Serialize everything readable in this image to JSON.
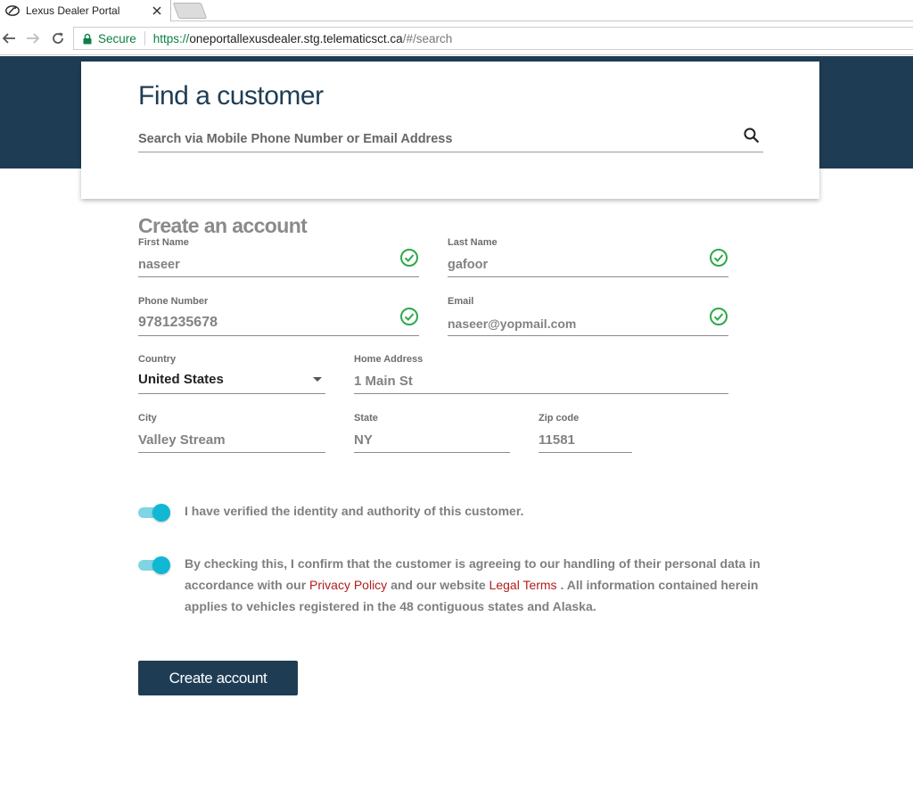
{
  "browser": {
    "tab_title": "Lexus Dealer Portal",
    "secure_label": "Secure",
    "url_scheme": "https://",
    "url_host": "oneportallexusdealer.stg.telematicsct.ca",
    "url_path": "/#/search"
  },
  "search": {
    "title": "Find a customer",
    "placeholder": "Search via Mobile Phone Number or Email Address"
  },
  "form": {
    "title": "Create an account",
    "first_name": {
      "label": "First Name",
      "value": "naseer"
    },
    "last_name": {
      "label": "Last Name",
      "value": "gafoor"
    },
    "phone": {
      "label": "Phone Number",
      "value": "9781235678"
    },
    "email": {
      "label": "Email",
      "value": "naseer@yopmail.com"
    },
    "country": {
      "label": "Country",
      "value": "United States"
    },
    "address": {
      "label": "Home Address",
      "value": "1 Main St"
    },
    "city": {
      "label": "City",
      "value": "Valley Stream"
    },
    "state": {
      "label": "State",
      "value": "NY"
    },
    "zip": {
      "label": "Zip code",
      "value": "11581"
    }
  },
  "consent": {
    "verify_text": "I have verified the identity and authority of this customer.",
    "agree_text_1": "By checking this, I confirm that the customer is agreeing to our handling of their personal data in accordance with our ",
    "privacy_link": "Privacy Policy",
    "agree_text_2": " and our website ",
    "legal_link": "Legal Terms",
    "agree_text_3": " . All information contained herein applies to vehicles registered in the 48 contiguous states and Alaska."
  },
  "submit_label": "Create account",
  "colors": {
    "brand_navy": "#1e3d54",
    "toggle_on": "#10b8d4",
    "valid_green": "#2ea84a",
    "link_red": "#b01e1e"
  }
}
